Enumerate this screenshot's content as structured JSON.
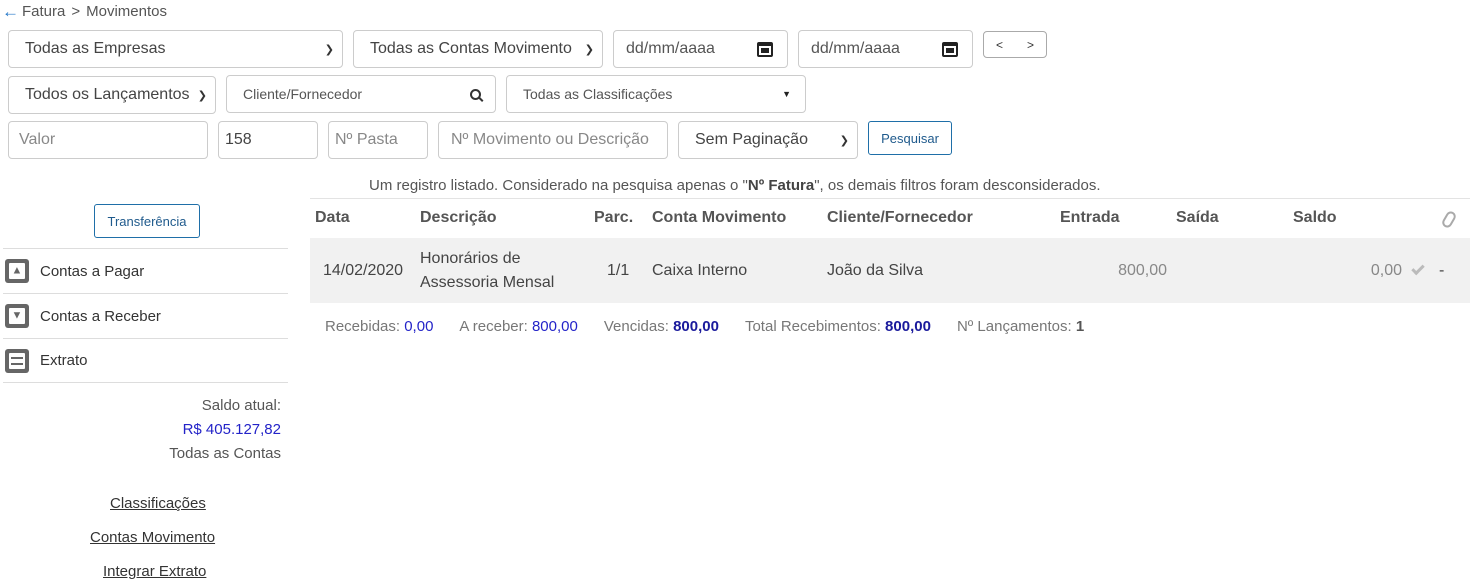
{
  "breadcrumb": {
    "parent": "Fatura",
    "separator": ">",
    "current": "Movimentos"
  },
  "filters": {
    "empresas": "Todas as Empresas",
    "contas_movimento": "Todas as Contas Movimento",
    "data_inicio": "dd/mm/aaaa",
    "data_fim": "dd/mm/aaaa",
    "nav_prev": "<",
    "nav_next": ">",
    "lancamentos": "Todos os Lançamentos",
    "cliente_placeholder": "Cliente/Fornecedor",
    "classificacoes": "Todas as Classificações",
    "valor_placeholder": "Valor",
    "fatura_value": "158",
    "pasta_placeholder": "Nº Pasta",
    "movimento_placeholder": "Nº Movimento ou Descrição",
    "paginacao": "Sem Paginação",
    "pesquisar": "Pesquisar"
  },
  "info": {
    "prefix": "Um registro listado. Considerado na pesquisa apenas o \"",
    "bold": "Nº Fatura",
    "suffix": "\", os demais filtros foram desconsiderados."
  },
  "sidebar": {
    "transferencia": "Transferência",
    "items": [
      {
        "label": "Contas a Pagar",
        "icon": "upload-box-icon"
      },
      {
        "label": "Contas a Receber",
        "icon": "download-box-icon"
      },
      {
        "label": "Extrato",
        "icon": "statement-icon"
      }
    ],
    "saldo_label": "Saldo atual:",
    "saldo_value": "R$ 405.127,82",
    "saldo_sub": "Todas as Contas",
    "links": [
      "Classificações",
      "Contas Movimento",
      "Integrar Extrato"
    ]
  },
  "table": {
    "headers": {
      "data": "Data",
      "descricao": "Descrição",
      "parc": "Parc.",
      "conta": "Conta Movimento",
      "cliente": "Cliente/Fornecedor",
      "entrada": "Entrada",
      "saida": "Saída",
      "saldo": "Saldo"
    },
    "rows": [
      {
        "data": "14/02/2020",
        "descricao_l1": "Honorários de",
        "descricao_l2": "Assessoria Mensal",
        "parc": "1/1",
        "conta": "Caixa Interno",
        "cliente": "João da Silva",
        "entrada": "800,00",
        "saida": "",
        "saldo": "0,00",
        "anexo": "-"
      }
    ]
  },
  "summary": {
    "recebidas_label": "Recebidas:",
    "recebidas": "0,00",
    "a_receber_label": "A receber:",
    "a_receber": "800,00",
    "vencidas_label": "Vencidas:",
    "vencidas": "800,00",
    "total_label": "Total Recebimentos:",
    "total": "800,00",
    "lancamentos_label": "Nº Lançamentos:",
    "lancamentos": "1"
  },
  "colors": {
    "accent": "#1f6fa8",
    "link_blue": "#2323c8",
    "row_bg": "#f1f1f1"
  }
}
